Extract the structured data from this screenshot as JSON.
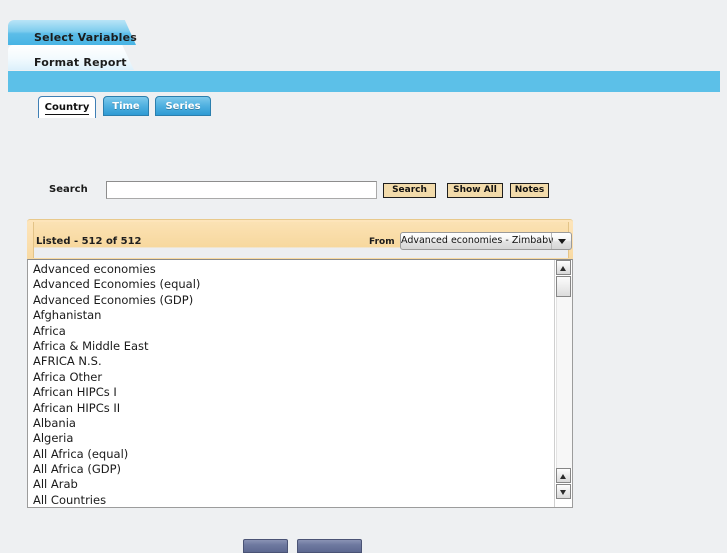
{
  "page_tabs": [
    {
      "label": "Select Variables",
      "active": true
    },
    {
      "label": "Format Report",
      "active": false
    }
  ],
  "inner_tabs": [
    {
      "label": "Country",
      "active": true
    },
    {
      "label": "Time",
      "active": false
    },
    {
      "label": "Series",
      "active": false
    }
  ],
  "search": {
    "label": "Search",
    "value": "",
    "placeholder": "",
    "buttons": {
      "search": "Search",
      "show_all": "Show All",
      "notes": "Notes"
    }
  },
  "listed_panel": {
    "status": "Listed - 512 of 512",
    "from_label": "From",
    "range_selected": "Advanced economies - Zimbabwe",
    "dropdown_icon": "chevron-down-icon"
  },
  "list": {
    "items": [
      "Advanced economies",
      "Advanced Economies (equal)",
      "Advanced Economies (GDP)",
      "Afghanistan",
      "Africa",
      "Africa & Middle East",
      "AFRICA N.S.",
      "Africa Other",
      "African HIPCs I",
      "African HIPCs II",
      "Albania",
      "Algeria",
      "All Africa (equal)",
      "All Africa (GDP)",
      "All Arab",
      "All Countries"
    ]
  },
  "scrollbar": {
    "top_up_icon": "scroll-up-icon",
    "bottom_up_icon": "scroll-up-icon",
    "bottom_down_icon": "scroll-down-icon"
  },
  "colors": {
    "band_blue": "#5cc0e8",
    "tab_blue": "#48b4e4",
    "panel_tan": "#f9dca7",
    "button_tan": "#f2dbab",
    "page_bg": "#eef0f2"
  }
}
